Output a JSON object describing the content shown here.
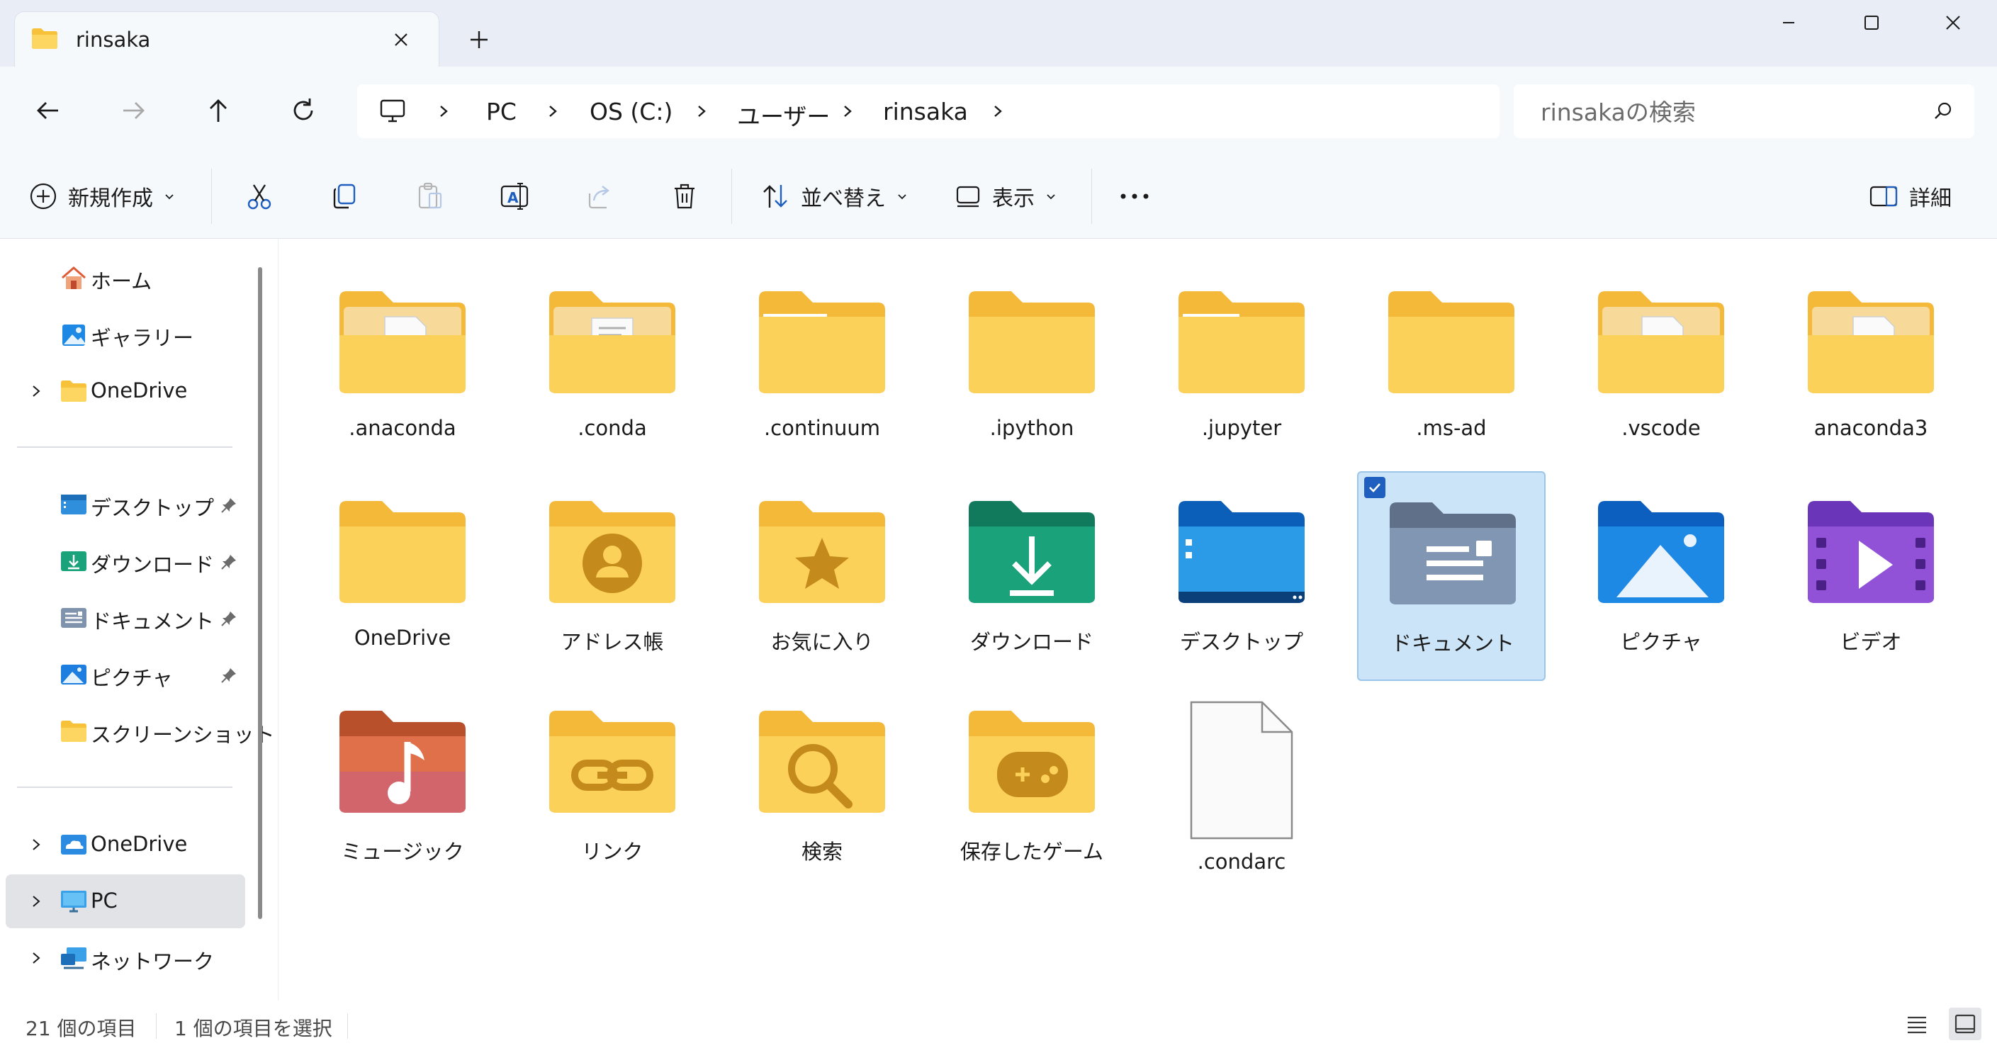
{
  "window": {
    "tab_title": "rinsaka",
    "new_tab": "+"
  },
  "address": {
    "crumbs": [
      "PC",
      "OS (C:)",
      "ユーザー",
      "rinsaka"
    ]
  },
  "search": {
    "placeholder": "rinsakaの検索"
  },
  "toolbar": {
    "new_label": "新規作成",
    "sort_label": "並べ替え",
    "view_label": "表示",
    "details_label": "詳細"
  },
  "sidebar": {
    "home": "ホーム",
    "gallery": "ギャラリー",
    "onedrive": "OneDrive",
    "quick": [
      "デスクトップ",
      "ダウンロード",
      "ドキュメント",
      "ピクチャ",
      "スクリーンショット"
    ],
    "onedrive2": "OneDrive",
    "pc": "PC",
    "network": "ネットワーク"
  },
  "items": [
    ".anaconda",
    ".conda",
    ".continuum",
    ".ipython",
    ".jupyter",
    ".ms-ad",
    ".vscode",
    "anaconda3",
    "OneDrive",
    "アドレス帳",
    "お気に入り",
    "ダウンロード",
    "デスクトップ",
    "ドキュメント",
    "ピクチャ",
    "ビデオ",
    "ミュージック",
    "リンク",
    "検索",
    "保存したゲーム",
    ".condarc"
  ],
  "status": {
    "count": "21 個の項目",
    "selected": "1 個の項目を選択"
  },
  "colors": {
    "folder": "#f9c940",
    "selection": "#cce4f7",
    "accent": "#1f5fbf"
  }
}
